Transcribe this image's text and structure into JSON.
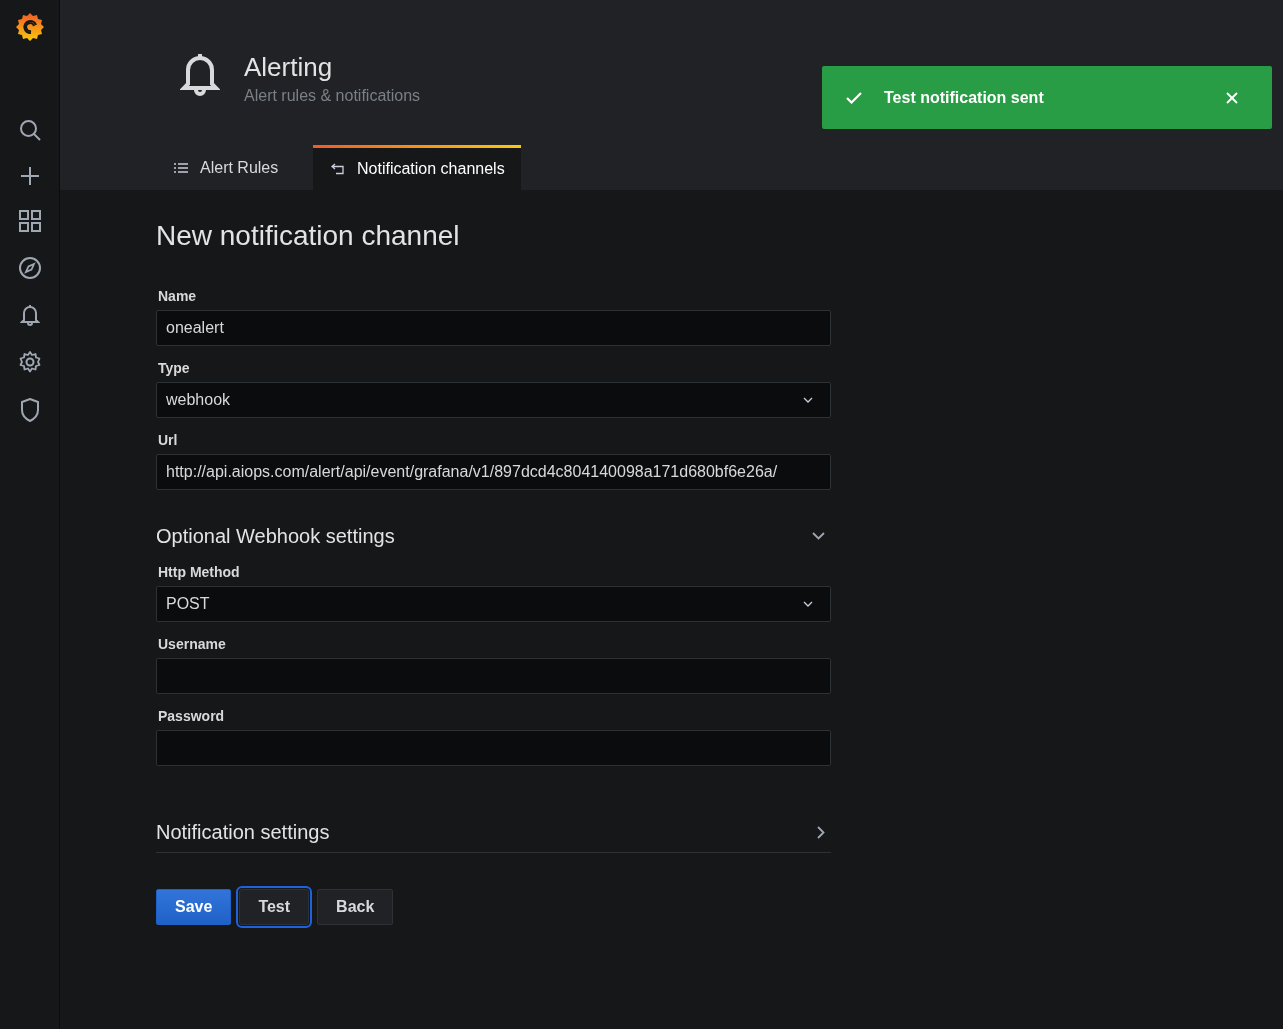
{
  "header": {
    "title": "Alerting",
    "subtitle": "Alert rules & notifications"
  },
  "tabs": [
    {
      "label": "Alert Rules",
      "kind": "list",
      "selected": false
    },
    {
      "label": "Notification channels",
      "kind": "channels",
      "selected": true
    }
  ],
  "page_title": "New notification channel",
  "fields": [
    {
      "label": "Name",
      "kind": "text",
      "value": "onealert"
    },
    {
      "label": "Type",
      "kind": "select",
      "value": "webhook"
    },
    {
      "label": "Url",
      "kind": "text",
      "value": "http://api.aiops.com/alert/api/event/grafana/v1/897dcd4c804140098a171d680bf6e26a/"
    }
  ],
  "sections": [
    {
      "title": "Optional Webhook settings",
      "expanded": true,
      "fields": [
        {
          "label": "Http Method",
          "kind": "select",
          "value": "POST"
        },
        {
          "label": "Username",
          "kind": "text"
        },
        {
          "label": "Password",
          "kind": "password"
        }
      ]
    },
    {
      "title": "Notification settings",
      "expanded": false
    }
  ],
  "buttons": [
    {
      "label": "Save",
      "kind": "primary",
      "focused": false
    },
    {
      "label": "Test",
      "kind": "secondary",
      "focused": true
    },
    {
      "label": "Back",
      "kind": "secondary",
      "focused": false
    }
  ],
  "toast": {
    "kind": "success",
    "message": "Test notification sent"
  }
}
